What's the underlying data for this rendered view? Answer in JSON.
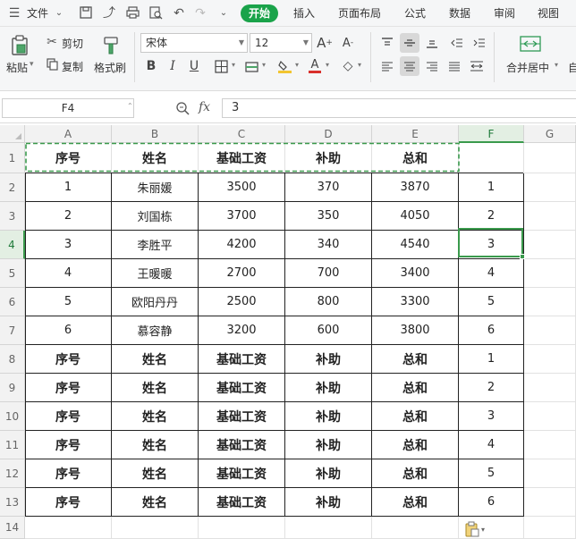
{
  "menu": {
    "file_label": "文件",
    "tabs": [
      "开始",
      "插入",
      "页面布局",
      "公式",
      "数据",
      "审阅",
      "视图"
    ],
    "active_tab": "开始"
  },
  "ribbon": {
    "paste_label": "粘贴",
    "cut_label": "剪切",
    "copy_label": "复制",
    "format_painter_label": "格式刷",
    "font_name": "宋体",
    "font_size": "12",
    "merge_label": "合并居中",
    "merge_truncated": "自"
  },
  "formula_bar": {
    "name_box": "F4",
    "fx_label": "fx",
    "value": "3"
  },
  "sheet": {
    "columns": [
      "A",
      "B",
      "C",
      "D",
      "E",
      "F",
      "G"
    ],
    "selected_column": "F",
    "selected_row": 4,
    "row_numbers": [
      "1",
      "2",
      "3",
      "4",
      "5",
      "6",
      "7",
      "8",
      "9",
      "10",
      "11",
      "12",
      "13",
      "14"
    ],
    "header_row": [
      "序号",
      "姓名",
      "基础工资",
      "补助",
      "总和"
    ],
    "data_rows": [
      [
        "1",
        "朱丽媛",
        "3500",
        "370",
        "3870",
        "1"
      ],
      [
        "2",
        "刘国栋",
        "3700",
        "350",
        "4050",
        "2"
      ],
      [
        "3",
        "李胜平",
        "4200",
        "340",
        "4540",
        "3"
      ],
      [
        "4",
        "王暖暖",
        "2700",
        "700",
        "3400",
        "4"
      ],
      [
        "5",
        "欧阳丹丹",
        "2500",
        "800",
        "3300",
        "5"
      ],
      [
        "6",
        "慕容静",
        "3200",
        "600",
        "3800",
        "6"
      ]
    ],
    "repeated_rows": [
      [
        "序号",
        "姓名",
        "基础工资",
        "补助",
        "总和",
        "1"
      ],
      [
        "序号",
        "姓名",
        "基础工资",
        "补助",
        "总和",
        "2"
      ],
      [
        "序号",
        "姓名",
        "基础工资",
        "补助",
        "总和",
        "3"
      ],
      [
        "序号",
        "姓名",
        "基础工资",
        "补助",
        "总和",
        "4"
      ],
      [
        "序号",
        "姓名",
        "基础工资",
        "补助",
        "总和",
        "5"
      ],
      [
        "序号",
        "姓名",
        "基础工资",
        "补助",
        "总和",
        "6"
      ]
    ]
  },
  "colors": {
    "accent": "#1aa34a",
    "selection": "#3a9a4c",
    "copy_marquee": "#3a9a4c"
  }
}
